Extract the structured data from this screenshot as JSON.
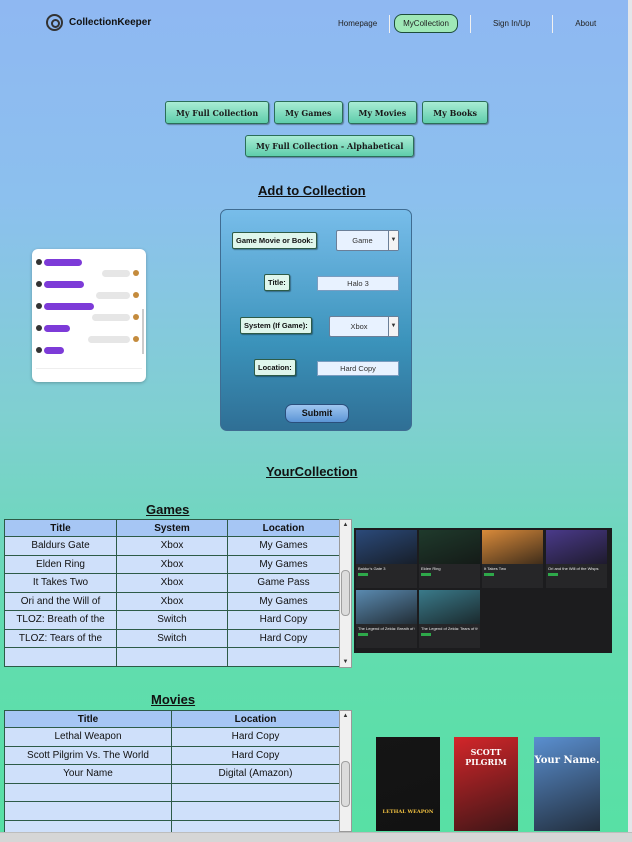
{
  "header": {
    "brand": "CollectionKeeper",
    "nav": [
      {
        "label": "Homepage"
      },
      {
        "label": "MyCollection",
        "active": true
      },
      {
        "label": "Sign In/Up"
      },
      {
        "label": "About"
      }
    ]
  },
  "categories": {
    "full": "My Full Collection",
    "games": "My Games",
    "movies": "My Movies",
    "books": "My Books",
    "alphabetical": "My Full Collection - Alphabetical"
  },
  "form": {
    "title": "Add to Collection",
    "type_label": "Game Movie or Book:",
    "type_value": "Game",
    "title_label": "Title:",
    "title_value": "Halo 3",
    "system_label": "System (If Game):",
    "system_value": "Xbox",
    "location_label": "Location:",
    "location_value": "Hard Copy",
    "submit": "Submit"
  },
  "collection": {
    "heading": "YourCollection",
    "games_heading": "Games",
    "games_columns": [
      "Title",
      "System",
      "Location"
    ],
    "games_rows": [
      [
        "Baldurs Gate",
        "Xbox",
        "My Games"
      ],
      [
        "Elden Ring",
        "Xbox",
        "My Games"
      ],
      [
        "It Takes Two",
        "Xbox",
        "Game Pass"
      ],
      [
        "Ori and the Will of",
        "Xbox",
        "My Games"
      ],
      [
        "TLOZ: Breath of the",
        "Switch",
        "Hard Copy"
      ],
      [
        "TLOZ: Tears of the",
        "Switch",
        "Hard Copy"
      ],
      [
        "",
        "",
        ""
      ]
    ],
    "movies_heading": "Movies",
    "movies_columns": [
      "Title",
      "Location"
    ],
    "movies_rows": [
      [
        "Lethal Weapon",
        "Hard Copy"
      ],
      [
        "Scott Pilgrim Vs. The World",
        "Hard Copy"
      ],
      [
        "Your Name",
        "Digital (Amazon)"
      ],
      [
        "",
        ""
      ],
      [
        "",
        ""
      ],
      [
        "",
        ""
      ]
    ]
  },
  "game_tiles": [
    {
      "caption": "Baldur's Gate 3",
      "color": "#2b4a7a"
    },
    {
      "caption": "Elden Ring",
      "color": "#1f3a2c"
    },
    {
      "caption": "It Takes Two",
      "color": "#d98a3a"
    },
    {
      "caption": "Ori and the Will of the Wisps",
      "color": "#4a3a8a"
    },
    {
      "caption": "The Legend of Zelda: Breath of the Wild",
      "color": "#5a8ab0"
    },
    {
      "caption": "The Legend of Zelda: Tears of the Kingdom",
      "color": "#3a7a8a"
    }
  ],
  "posters": [
    {
      "title": "LETHAL WEAPON",
      "color": "#151515"
    },
    {
      "title": "SCOTT PILGRIM",
      "color": "#d3262a"
    },
    {
      "title": "Your Name.",
      "color": "#5a8fd0"
    }
  ]
}
